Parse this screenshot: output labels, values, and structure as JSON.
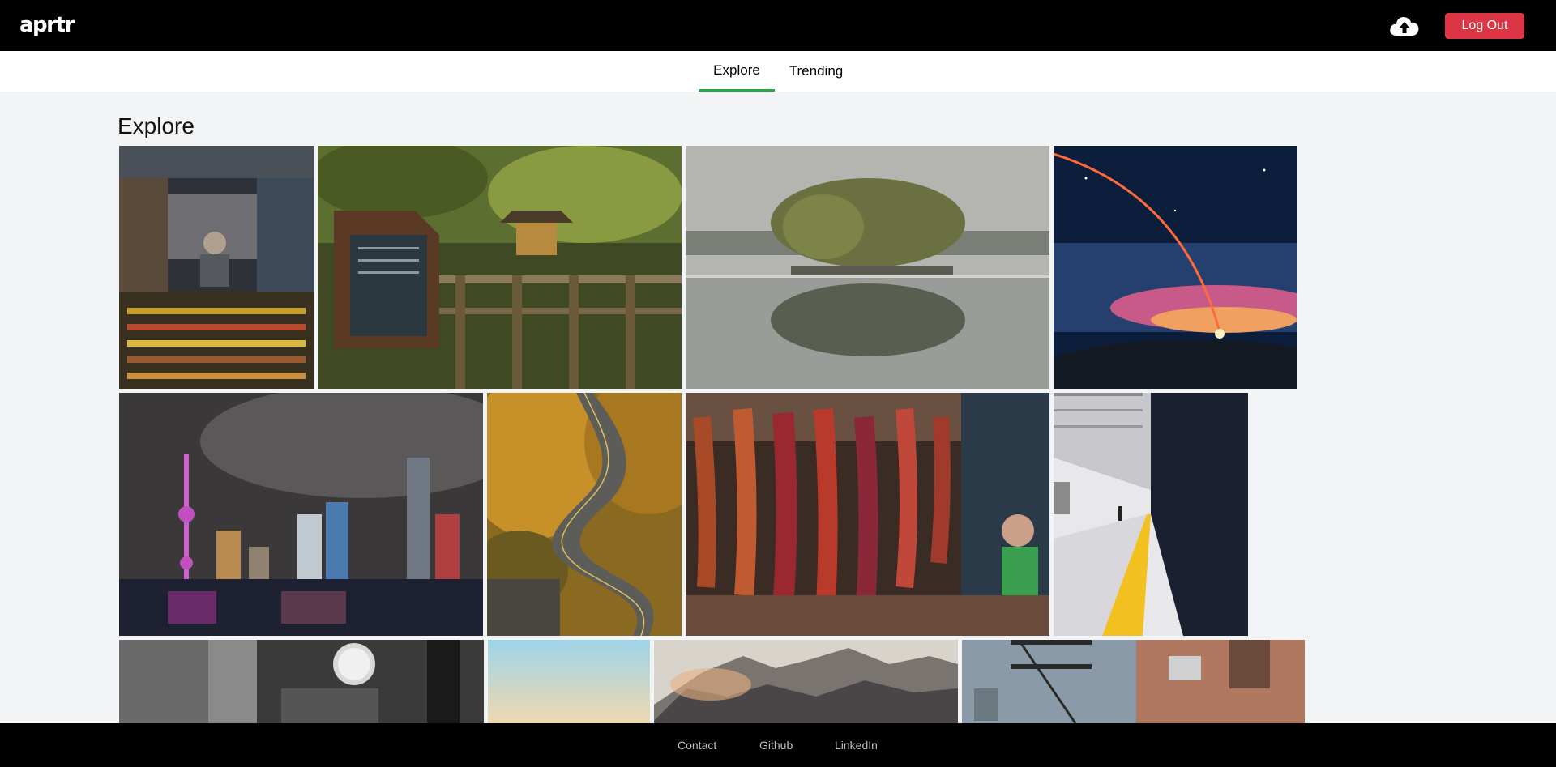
{
  "header": {
    "logo": "aprtr",
    "upload_icon": "cloud-upload-icon",
    "logout_label": "Log Out"
  },
  "tabs": [
    {
      "label": "Explore",
      "active": true
    },
    {
      "label": "Trending",
      "active": false
    }
  ],
  "main": {
    "title": "Explore",
    "photos": [
      {
        "subject": "collectibles shop with shopkeeper"
      },
      {
        "subject": "wooden shrine sign in forest"
      },
      {
        "subject": "willow island reflected in lake"
      },
      {
        "subject": "rocket launch trail at night"
      },
      {
        "subject": "Shanghai skyline at night"
      },
      {
        "subject": "winding road through autumn forest"
      },
      {
        "subject": "hanging dried chili peppers at market"
      },
      {
        "subject": "subway platform"
      },
      {
        "subject": "black and white street with clock"
      },
      {
        "subject": "pastel sky gradient"
      },
      {
        "subject": "mountain range at sunrise"
      },
      {
        "subject": "building facade with fire escape"
      }
    ]
  },
  "footer": {
    "links": [
      "Contact",
      "Github",
      "LinkedIn"
    ]
  },
  "colors": {
    "accent": "#28a745",
    "danger": "#dc3545",
    "header_bg": "#000000",
    "page_bg": "#f3f4f6"
  }
}
